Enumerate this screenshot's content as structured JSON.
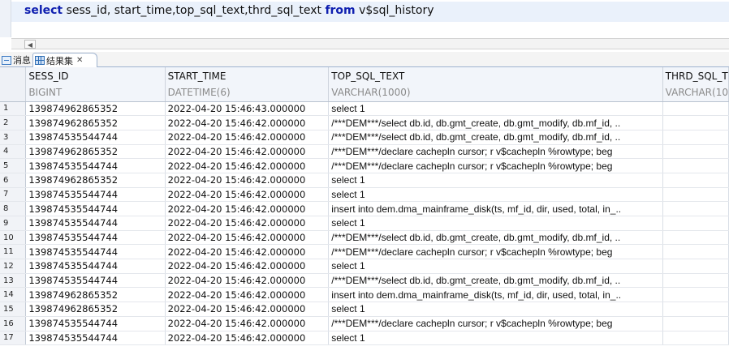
{
  "editor": {
    "sql_tokens": [
      {
        "text": "select",
        "kind": "kw"
      },
      {
        "text": " sess_id, start_time,top_sql_text,thrd_sql_text ",
        "kind": "tx"
      },
      {
        "text": "from",
        "kind": "kw"
      },
      {
        "text": " v$sql_history",
        "kind": "tx"
      }
    ]
  },
  "tabs": {
    "messages_label": "消息",
    "results_label": "结果集",
    "close_glyph": "✕"
  },
  "grid": {
    "columns": [
      {
        "name": "SESS_ID",
        "type": "BIGINT"
      },
      {
        "name": "START_TIME",
        "type": "DATETIME(6)"
      },
      {
        "name": "TOP_SQL_TEXT",
        "type": "VARCHAR(1000)"
      },
      {
        "name": "THRD_SQL_T",
        "type": "VARCHAR(10"
      }
    ],
    "rows": [
      {
        "n": "1",
        "sess_id": "139874962865352",
        "start_time": "2022-04-20 15:46:43.000000",
        "top_sql_text": "select 1",
        "thrd_sql_text": ""
      },
      {
        "n": "2",
        "sess_id": "139874962865352",
        "start_time": "2022-04-20 15:46:42.000000",
        "top_sql_text": "/***DEM***/select db.id, db.gmt_create, db.gmt_modify, db.mf_id, ..",
        "thrd_sql_text": ""
      },
      {
        "n": "3",
        "sess_id": "139874535544744",
        "start_time": "2022-04-20 15:46:42.000000",
        "top_sql_text": "/***DEM***/select db.id, db.gmt_create, db.gmt_modify, db.mf_id, ..",
        "thrd_sql_text": ""
      },
      {
        "n": "4",
        "sess_id": "139874962865352",
        "start_time": "2022-04-20 15:46:42.000000",
        "top_sql_text": "/***DEM***/declare  cachepln cursor;  r v$cachepln %rowtype;  beg",
        "thrd_sql_text": ""
      },
      {
        "n": "5",
        "sess_id": "139874535544744",
        "start_time": "2022-04-20 15:46:42.000000",
        "top_sql_text": "/***DEM***/declare  cachepln cursor;  r v$cachepln %rowtype;  beg",
        "thrd_sql_text": ""
      },
      {
        "n": "6",
        "sess_id": "139874962865352",
        "start_time": "2022-04-20 15:46:42.000000",
        "top_sql_text": "select 1",
        "thrd_sql_text": ""
      },
      {
        "n": "7",
        "sess_id": "139874535544744",
        "start_time": "2022-04-20 15:46:42.000000",
        "top_sql_text": "select 1",
        "thrd_sql_text": ""
      },
      {
        "n": "8",
        "sess_id": "139874535544744",
        "start_time": "2022-04-20 15:46:42.000000",
        "top_sql_text": "insert into dem.dma_mainframe_disk(ts, mf_id, dir, used, total, in_..",
        "thrd_sql_text": ""
      },
      {
        "n": "9",
        "sess_id": "139874535544744",
        "start_time": "2022-04-20 15:46:42.000000",
        "top_sql_text": "select 1",
        "thrd_sql_text": ""
      },
      {
        "n": "10",
        "sess_id": "139874535544744",
        "start_time": "2022-04-20 15:46:42.000000",
        "top_sql_text": "/***DEM***/select db.id, db.gmt_create, db.gmt_modify, db.mf_id, ..",
        "thrd_sql_text": ""
      },
      {
        "n": "11",
        "sess_id": "139874535544744",
        "start_time": "2022-04-20 15:46:42.000000",
        "top_sql_text": "/***DEM***/declare  cachepln cursor;  r v$cachepln %rowtype;  beg",
        "thrd_sql_text": ""
      },
      {
        "n": "12",
        "sess_id": "139874535544744",
        "start_time": "2022-04-20 15:46:42.000000",
        "top_sql_text": "select 1",
        "thrd_sql_text": ""
      },
      {
        "n": "13",
        "sess_id": "139874535544744",
        "start_time": "2022-04-20 15:46:42.000000",
        "top_sql_text": "/***DEM***/select db.id, db.gmt_create, db.gmt_modify, db.mf_id, ..",
        "thrd_sql_text": ""
      },
      {
        "n": "14",
        "sess_id": "139874962865352",
        "start_time": "2022-04-20 15:46:42.000000",
        "top_sql_text": "insert into dem.dma_mainframe_disk(ts, mf_id, dir, used, total, in_..",
        "thrd_sql_text": ""
      },
      {
        "n": "15",
        "sess_id": "139874962865352",
        "start_time": "2022-04-20 15:46:42.000000",
        "top_sql_text": "select 1",
        "thrd_sql_text": ""
      },
      {
        "n": "16",
        "sess_id": "139874535544744",
        "start_time": "2022-04-20 15:46:42.000000",
        "top_sql_text": "/***DEM***/declare  cachepln cursor;  r v$cachepln %rowtype;  beg",
        "thrd_sql_text": ""
      },
      {
        "n": "17",
        "sess_id": "139874535544744",
        "start_time": "2022-04-20 15:46:42.000000",
        "top_sql_text": "select 1",
        "thrd_sql_text": ""
      }
    ]
  },
  "colors": {
    "keyword": "#1020b0",
    "header_bg": "#f2f5fa",
    "type_text": "#8a8a8a",
    "current_line": "#eaf1fb"
  }
}
